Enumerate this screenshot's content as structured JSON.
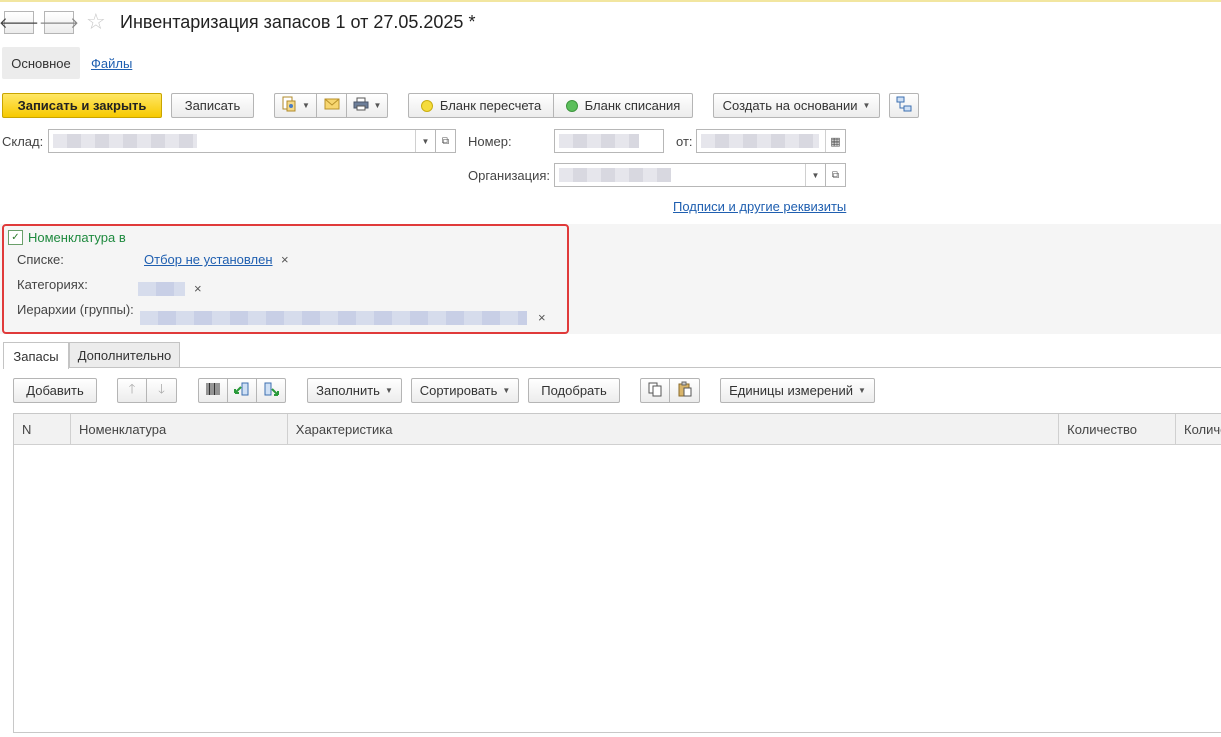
{
  "window": {
    "title": "Инвентаризация запасов 1 от 27.05.2025 *",
    "back_glyph": "🡐",
    "forward_glyph": "🡒",
    "star_glyph": "☆"
  },
  "nav_tabs": {
    "main": "Основное",
    "files": "Файлы"
  },
  "toolbar": {
    "save_close": "Записать и закрыть",
    "save": "Записать",
    "recount_form": "Бланк пересчета",
    "writeoff_form": "Бланк списания",
    "create_based": "Создать на основании",
    "colors": {
      "recount_dot": "#f5dc3c",
      "writeoff_dot": "#5cbf5c"
    }
  },
  "form": {
    "warehouse_label": "Склад:",
    "number_label": "Номер:",
    "date_label": "от:",
    "org_label": "Организация:",
    "signatures_link": "Подписи и другие реквизиты"
  },
  "filter": {
    "group_title": "Номенклатура в",
    "list_label": "Списке:",
    "list_value": "Отбор не установлен",
    "categories_label": "Категориях:",
    "hierarchy_label": "Иерархии (группы):",
    "clear_glyph": "×"
  },
  "content_tabs": {
    "stocks": "Запасы",
    "additional": "Дополнительно"
  },
  "table_toolbar": {
    "add": "Добавить",
    "fill": "Заполнить",
    "sort": "Сортировать",
    "pick": "Подобрать",
    "units": "Единицы измерений"
  },
  "table": {
    "columns": [
      "N",
      "Номенклатура",
      "Характеристика",
      "Количество",
      "Количество"
    ]
  }
}
